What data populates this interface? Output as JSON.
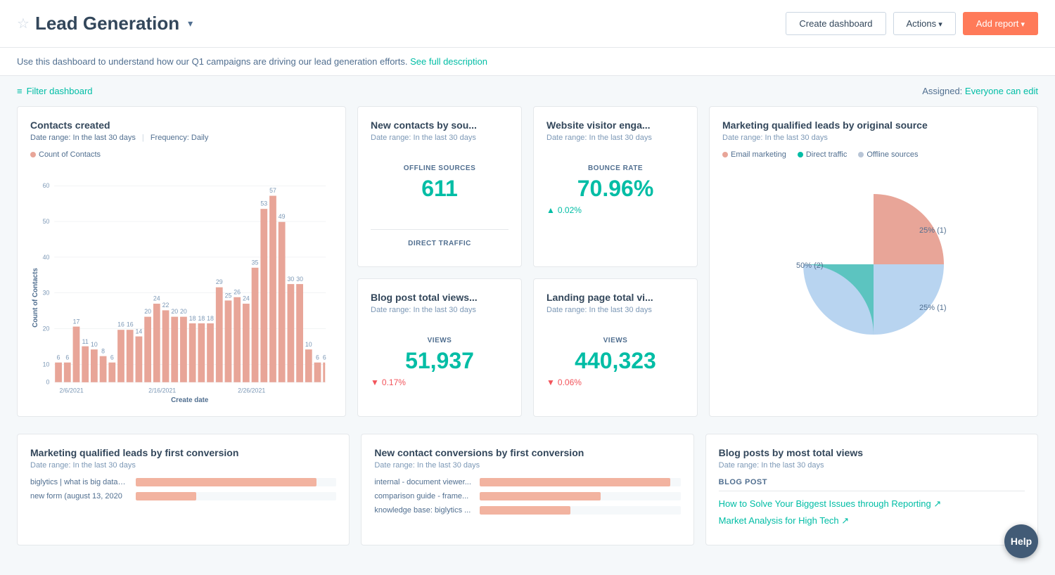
{
  "header": {
    "title": "Lead Generation",
    "star_label": "☆",
    "chevron": "▾",
    "create_dashboard": "Create dashboard",
    "actions": "Actions",
    "add_report": "Add report"
  },
  "description": {
    "text": "Use this dashboard to understand how our Q1 campaigns are driving our lead generation efforts.",
    "link_text": "See full description"
  },
  "filter_bar": {
    "filter_label": "Filter dashboard",
    "assigned_label": "Assigned:",
    "assigned_value": "Everyone can edit"
  },
  "contacts_created": {
    "title": "Contacts created",
    "date_range": "Date range: In the last 30 days",
    "frequency": "Frequency: Daily",
    "legend_label": "Count of Contacts",
    "y_axis_label": "Count of Contacts",
    "x_axis_label": "Create date",
    "bars": [
      {
        "date": "2/6",
        "value": 6,
        "label": "6"
      },
      {
        "date": "2/7",
        "value": 6,
        "label": "6"
      },
      {
        "date": "2/8",
        "value": 17,
        "label": "17"
      },
      {
        "date": "2/9",
        "value": 11,
        "label": "11"
      },
      {
        "date": "2/10",
        "value": 10,
        "label": "10"
      },
      {
        "date": "2/11",
        "value": 8,
        "label": "8"
      },
      {
        "date": "2/12",
        "value": 6,
        "label": "6"
      },
      {
        "date": "2/13",
        "value": 16,
        "label": "16"
      },
      {
        "date": "2/14",
        "value": 16,
        "label": "16"
      },
      {
        "date": "2/15",
        "value": 14,
        "label": "14"
      },
      {
        "date": "2/16",
        "value": 20,
        "label": "20"
      },
      {
        "date": "2/17",
        "value": 24,
        "label": "24"
      },
      {
        "date": "2/18",
        "value": 22,
        "label": "22"
      },
      {
        "date": "2/19",
        "value": 20,
        "label": "20"
      },
      {
        "date": "2/20",
        "value": 20,
        "label": "20"
      },
      {
        "date": "2/21",
        "value": 18,
        "label": "18"
      },
      {
        "date": "2/22",
        "value": 18,
        "label": "18"
      },
      {
        "date": "2/23",
        "value": 18,
        "label": "18"
      },
      {
        "date": "2/24",
        "value": 29,
        "label": "29"
      },
      {
        "date": "2/25",
        "value": 25,
        "label": "25"
      },
      {
        "date": "2/26",
        "value": 26,
        "label": "26"
      },
      {
        "date": "2/27",
        "value": 24,
        "label": "24"
      },
      {
        "date": "2/28",
        "value": 35,
        "label": "35"
      },
      {
        "date": "3/1",
        "value": 53,
        "label": "53"
      },
      {
        "date": "3/2",
        "value": 57,
        "label": "57"
      },
      {
        "date": "3/3",
        "value": 49,
        "label": "49"
      },
      {
        "date": "3/4",
        "value": 30,
        "label": "30"
      },
      {
        "date": "3/5",
        "value": 30,
        "label": "30"
      },
      {
        "date": "3/6",
        "value": 10,
        "label": "10"
      },
      {
        "date": "3/7",
        "value": 6,
        "label": "6"
      },
      {
        "date": "3/8",
        "value": 6,
        "label": "6"
      }
    ],
    "x_ticks": [
      "2/6/2021",
      "2/16/2021",
      "2/26/2021"
    ]
  },
  "new_contacts": {
    "title": "New contacts by sou...",
    "date_range": "Date range: In the last 30 days",
    "metric_label": "OFFLINE SOURCES",
    "metric_value": "611",
    "divider_label": "DIRECT TRAFFIC"
  },
  "website_visitor": {
    "title": "Website visitor enga...",
    "date_range": "Date range: In the last 30 days",
    "metric_label": "BOUNCE RATE",
    "metric_value": "70.96%",
    "change_value": "0.02%",
    "change_direction": "up"
  },
  "mql_source": {
    "title": "Marketing qualified leads by original source",
    "date_range": "Date range: In the last 30 days",
    "legend": [
      {
        "label": "Email marketing",
        "color": "#e8a598"
      },
      {
        "label": "Direct traffic",
        "color": "#00bda5"
      },
      {
        "label": "Offline sources",
        "color": "#b8c5d6"
      }
    ],
    "slices": [
      {
        "label": "25% (1)",
        "percent": 25,
        "color": "#e8a598",
        "position": "right-top"
      },
      {
        "label": "50% (2)",
        "percent": 50,
        "color": "#b8d4f0",
        "position": "left"
      },
      {
        "label": "25% (1)",
        "percent": 25,
        "color": "#5cc4c0",
        "position": "right-bottom"
      }
    ]
  },
  "blog_views": {
    "title": "Blog post total views...",
    "date_range": "Date range: In the last 30 days",
    "metric_label": "VIEWS",
    "metric_value": "51,937",
    "change_value": "0.17%",
    "change_direction": "down"
  },
  "landing_views": {
    "title": "Landing page total vi...",
    "date_range": "Date range: In the last 30 days",
    "metric_label": "VIEWS",
    "metric_value": "440,323",
    "change_value": "0.06%",
    "change_direction": "down"
  },
  "mql_first_conversion": {
    "title": "Marketing qualified leads by first conversion",
    "date_range": "Date range: In the last 30 days",
    "items": [
      {
        "label": "biglytics | what is big data?: ebook form",
        "bar_pct": 90
      },
      {
        "label": "new form (august 13, 2020",
        "bar_pct": 30
      }
    ]
  },
  "new_contact_conversions": {
    "title": "New contact conversions by first conversion",
    "date_range": "Date range: In the last 30 days",
    "items": [
      {
        "label": "internal - document viewer...",
        "bar_pct": 95
      },
      {
        "label": "comparison guide - frame...",
        "bar_pct": 60
      },
      {
        "label": "knowledge base: biglytics ...",
        "bar_pct": 45
      }
    ]
  },
  "blog_most_views": {
    "title": "Blog posts by most total views",
    "date_range": "Date range: In the last 30 days",
    "header": "BLOG POST",
    "links": [
      {
        "text": "How to Solve Your Biggest Issues through Reporting ↗"
      },
      {
        "text": "Market Analysis for High Tech ↗"
      }
    ]
  },
  "help": {
    "label": "Help"
  }
}
